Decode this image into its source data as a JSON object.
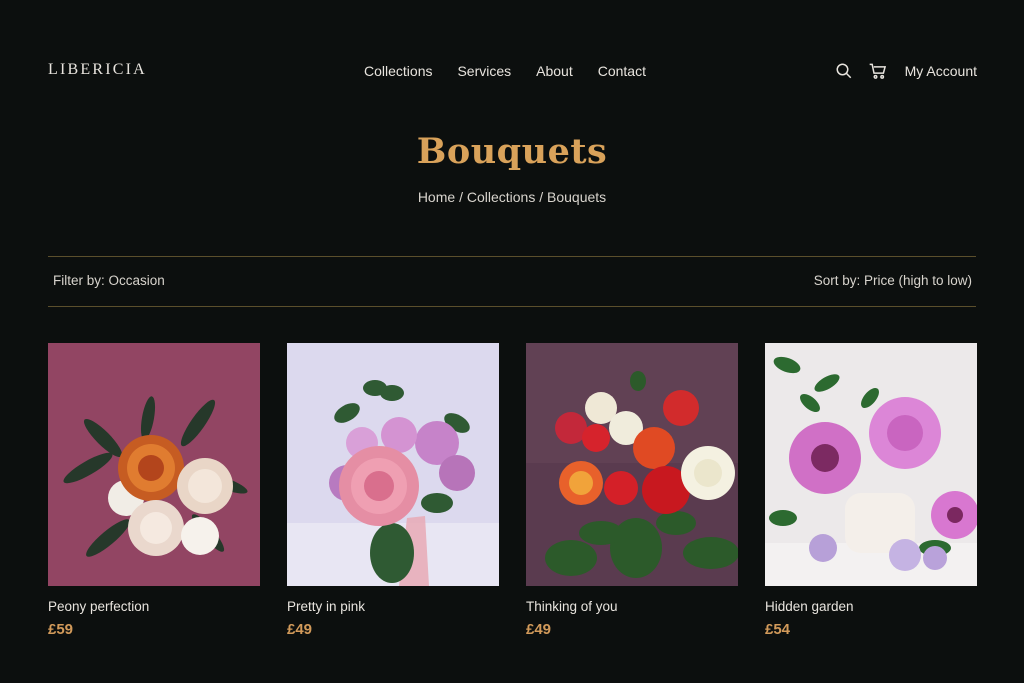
{
  "brand": {
    "logo": "LIBERICIA"
  },
  "nav": {
    "items": [
      {
        "label": "Collections"
      },
      {
        "label": "Services"
      },
      {
        "label": "About"
      },
      {
        "label": "Contact"
      }
    ]
  },
  "header_tools": {
    "search_icon": "search-icon",
    "cart_icon": "cart-icon",
    "account_label": "My Account"
  },
  "page": {
    "title": "Bouquets",
    "breadcrumb": [
      "Home",
      "Collections",
      "Bouquets"
    ],
    "breadcrumb_separator": "/"
  },
  "toolbar": {
    "filter_label": "Filter by: Occasion",
    "sort_label": "Sort by: Price (high to low)"
  },
  "products": [
    {
      "name": "Peony perfection",
      "price": "£59",
      "image_bg": "#9a4b68"
    },
    {
      "name": "Pretty in pink",
      "price": "£49",
      "image_bg": "#dcd9ee"
    },
    {
      "name": "Thinking of you",
      "price": "£49",
      "image_bg": "#5a3b4f"
    },
    {
      "name": "Hidden garden",
      "price": "£54",
      "image_bg": "#ece9ea"
    }
  ],
  "colors": {
    "background": "#0c0f0e",
    "accent": "#d9a25a",
    "price": "#d29a5a",
    "divider": "#5b4f2c"
  }
}
